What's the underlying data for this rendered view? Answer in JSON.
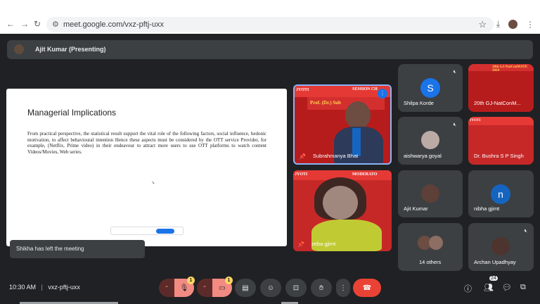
{
  "browser": {
    "url": "meet.google.com/vxz-pftj-uxx",
    "icons": [
      "back-arrow-icon",
      "forward-arrow-icon",
      "reload-icon",
      "site-settings-icon",
      "star-icon",
      "download-icon",
      "profile-avatar",
      "more-vert-icon"
    ]
  },
  "presenter_bar": {
    "label": "Ajit Kumar (Presenting)"
  },
  "slide": {
    "title": "Managerial Implications",
    "body": "From practical perspective, the statistical result support the vital role of the following factors, social influence, hedonic motivation, to affect behavioural intention Hence these aspects must be considered by the OTT service Provider, for example, (Netflix, Prime video) in their endeavour to attract more users to use OTT platforms to watch content Videos/Movies, Web series."
  },
  "toast": {
    "text": "Shikha has left the meeting"
  },
  "videos": [
    {
      "name": "Subrahmanya Bhat",
      "banner_top": "SESSION CH",
      "banner_name": "Prof. (Dr.) Sub",
      "header_logo": "JYOTI",
      "accent": "#c62828"
    },
    {
      "name": "zeba gjimt",
      "banner_top": "MODERATO",
      "header_logo": "JYOTI",
      "accent": "#c62828"
    }
  ],
  "tiles": [
    {
      "name": "Shilpa Korde",
      "initial": "S",
      "color": "#1a73e8",
      "muted": true,
      "type": "initial"
    },
    {
      "name": "20th GJ-NatConM...",
      "type": "banner",
      "banner_text": "20th GJ-NatConMATE 2024"
    },
    {
      "name": "aishwarya goyal",
      "muted": true,
      "type": "photo"
    },
    {
      "name": "Dr. Bushra S P Singh",
      "type": "banner",
      "banner_text": "JYOTI"
    },
    {
      "name": "Ajit Kumar",
      "type": "photo"
    },
    {
      "name": "nibha gjimt",
      "initial": "n",
      "color": "#1565c0",
      "type": "initial"
    },
    {
      "name": "14 others",
      "type": "group"
    },
    {
      "name": "Archan Upadhyay",
      "muted": true,
      "type": "photo"
    }
  ],
  "bottom": {
    "time": "10:30 AM",
    "separator": "|",
    "meeting_code": "vxz-pftj-uxx",
    "mic_badge": "1",
    "cam_badge": "1",
    "people_count": "24"
  }
}
